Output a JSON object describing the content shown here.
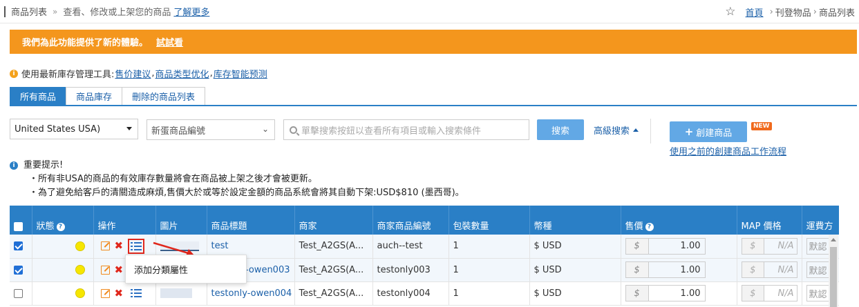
{
  "topbar": {
    "title": "商品列表",
    "separator": "»",
    "description": "查看、修改或上架您的商品",
    "learn_more": "了解更多",
    "star_icon": "star-icon",
    "home": "首頁",
    "crumb_sep": "›",
    "crumb1": "刊登物品",
    "crumb2": "商品列表"
  },
  "banner": {
    "message": "我們為此功能提供了新的體驗。",
    "try_link": "試試看",
    "color": "#f4961d"
  },
  "tools": {
    "label": "使用最新庫存管理工具:",
    "link1": "售价建议",
    "comma": ",",
    "link2": "商品类型优化",
    "link3": "库存智能预测"
  },
  "tabs": [
    {
      "label": "所有商品",
      "active": true
    },
    {
      "label": "商品庫存",
      "active": false
    },
    {
      "label": "刪除的商品列表",
      "active": false
    }
  ],
  "filters": {
    "country": "United States USA)",
    "id_type": "新蛋商品編號",
    "search_placeholder": "單擊搜索按鈕以查看所有項目或輸入搜索條件",
    "search_button": "搜索",
    "advanced": "高級搜索",
    "create_button": "創建商品",
    "new_badge": "NEW",
    "prev_flow": "使用之前的創建商品工作流程"
  },
  "notice": {
    "title": "重要提示!",
    "line1": "・所有非USA的商品的有效庫存數量將會在商品被上架之後才會被更新。",
    "line2": "・為了避免給客戶的清關造成麻煩,售價大於或等於設定金額的商品系統會將其自動下架:USD$810 (墨西哥)。"
  },
  "table": {
    "headers": {
      "status": "狀態",
      "actions": "操作",
      "image": "圖片",
      "title": "商品標題",
      "seller": "商家",
      "seller_sku": "商家商品編號",
      "pack_qty": "包裝數量",
      "currency": "幣種",
      "price": "售價",
      "map_price": "MAP 價格",
      "shipping": "運費方"
    },
    "rows": [
      {
        "checked": true,
        "title": "test",
        "seller": "Test_A2GS(A...",
        "sku": "auch--test",
        "qty": "1",
        "currency": "$ USD",
        "cur_symbol": "$",
        "price": "1.00",
        "map_placeholder": "N/A",
        "shipping": "默認"
      },
      {
        "checked": true,
        "title": "-owen003",
        "seller": "Test_A2GS(A...",
        "sku": "testonly003",
        "qty": "1",
        "currency": "$ USD",
        "cur_symbol": "$",
        "price": "1.00",
        "map_placeholder": "N/A",
        "shipping": "默認"
      },
      {
        "checked": false,
        "title": "testonly-owen004",
        "seller": "Test_A2GS(A...",
        "sku": "testonly004",
        "qty": "1",
        "currency": "$ USD",
        "cur_symbol": "$",
        "price": "1.00",
        "map_placeholder": "N/A",
        "shipping": "默認"
      }
    ]
  },
  "popup": {
    "item": "添加分類屬性"
  },
  "colors": {
    "header_blue": "#2a7fc6",
    "button_blue": "#62a8e5",
    "link_blue": "#1a5fa8",
    "delete_red": "#e0271c",
    "status_yellow": "#f6e600"
  }
}
